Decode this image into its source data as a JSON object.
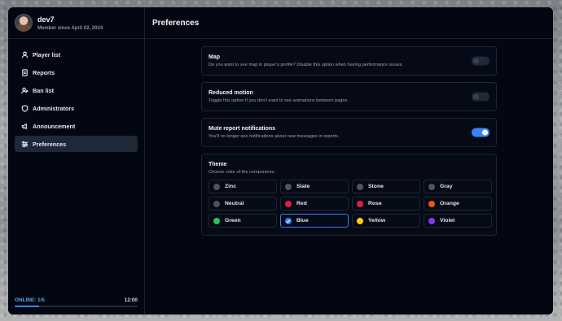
{
  "profile": {
    "username": "dev7",
    "member_since": "Member since April 02, 2024"
  },
  "nav": [
    {
      "label": "Player list",
      "icon": "user-icon",
      "active": false
    },
    {
      "label": "Reports",
      "icon": "document-icon",
      "active": false
    },
    {
      "label": "Ban list",
      "icon": "user-ban-icon",
      "active": false
    },
    {
      "label": "Administrators",
      "icon": "shield-icon",
      "active": false
    },
    {
      "label": "Announcement",
      "icon": "megaphone-icon",
      "active": false
    },
    {
      "label": "Preferences",
      "icon": "sliders-icon",
      "active": true
    }
  ],
  "online": {
    "label": "ONLINE: 1/5",
    "time": "12:00",
    "progress_fraction": 0.2
  },
  "header": {
    "title": "Preferences"
  },
  "settings": {
    "map": {
      "title": "Map",
      "description": "Do you want to see map in player's profile? Disable this option when having performance issues.",
      "enabled": false
    },
    "reduced_motion": {
      "title": "Reduced motion",
      "description": "Toggle this option if you don't want to see animations between pages.",
      "enabled": false
    },
    "mute_reports": {
      "title": "Mute report notifications",
      "description": "You'll no longer see notifications about new messages in reports.",
      "enabled": true
    }
  },
  "theme": {
    "title": "Theme",
    "description": "Choose color of the components.",
    "selected": "Blue",
    "options": [
      {
        "name": "Zinc",
        "color": "#52525b"
      },
      {
        "name": "Slate",
        "color": "#475569"
      },
      {
        "name": "Stone",
        "color": "#57534e"
      },
      {
        "name": "Gray",
        "color": "#4b5563"
      },
      {
        "name": "Neutral",
        "color": "#525252"
      },
      {
        "name": "Red",
        "color": "#e11d48"
      },
      {
        "name": "Rose",
        "color": "#e11d48"
      },
      {
        "name": "Orange",
        "color": "#ea580c"
      },
      {
        "name": "Green",
        "color": "#22c55e"
      },
      {
        "name": "Blue",
        "color": "#3b82f6"
      },
      {
        "name": "Yellow",
        "color": "#facc15"
      },
      {
        "name": "Violet",
        "color": "#7c3aed"
      }
    ]
  }
}
